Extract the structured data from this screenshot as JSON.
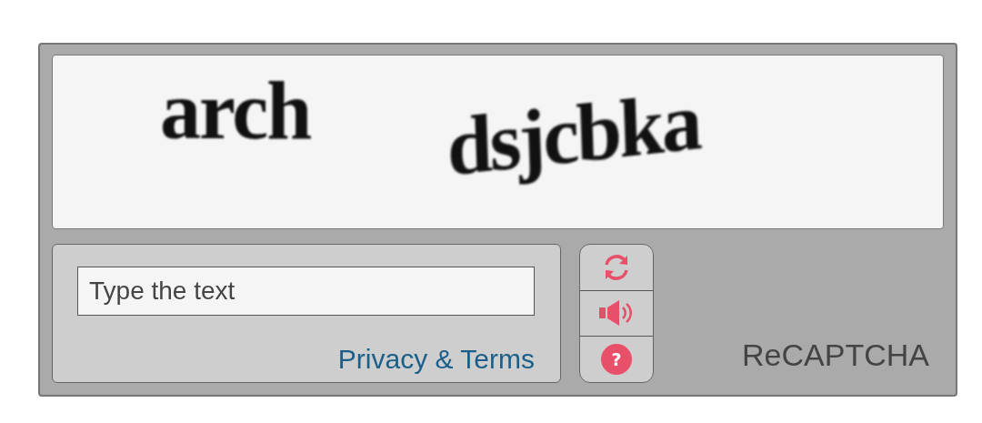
{
  "challenge": {
    "words": [
      "arch",
      "dsjcbka"
    ]
  },
  "answer": {
    "placeholder": "Type the text"
  },
  "privacy_link": "Privacy & Terms",
  "controls": [
    {
      "kind": "reload"
    },
    {
      "kind": "audio"
    },
    {
      "kind": "help",
      "symbol": "?"
    }
  ],
  "brand": "ReCAPTCHA"
}
